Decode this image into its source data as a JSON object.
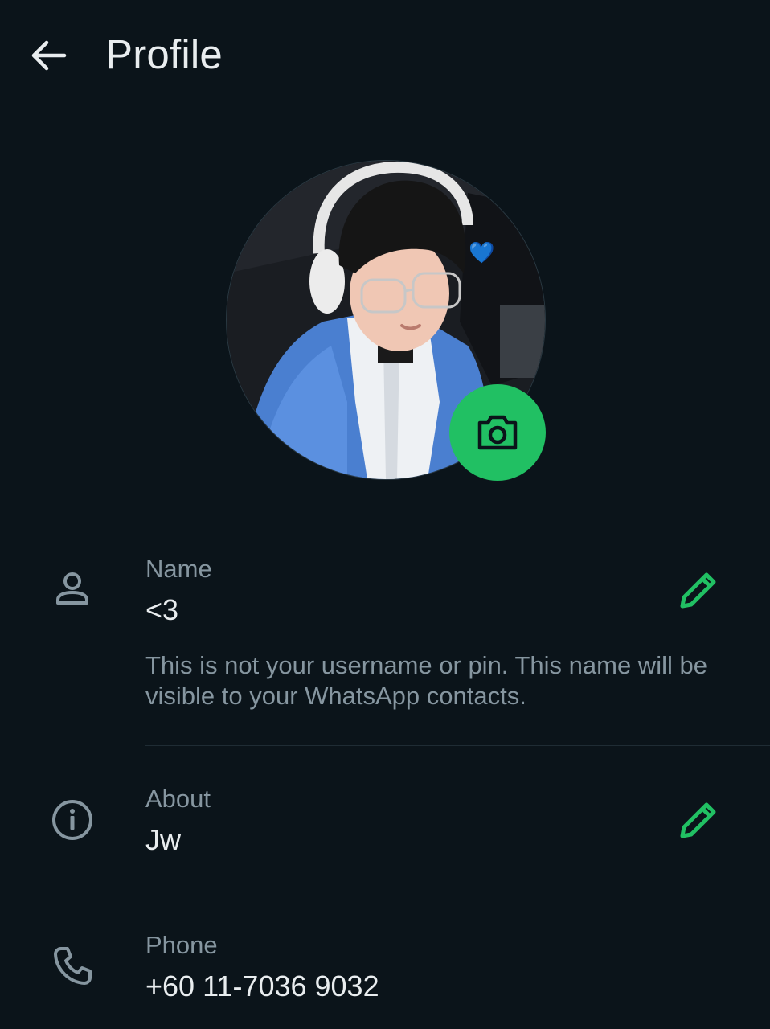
{
  "header": {
    "title": "Profile"
  },
  "profile": {
    "photo_emoji": "💙",
    "name": {
      "label": "Name",
      "value": "<3",
      "hint": "This is not your username or pin. This name will be visible to your WhatsApp contacts."
    },
    "about": {
      "label": "About",
      "value": "Jw"
    },
    "phone": {
      "label": "Phone",
      "value": "+60 11-7036 9032"
    }
  },
  "colors": {
    "accent": "#21c063",
    "background": "#0b141a",
    "secondary_text": "#8696a0"
  }
}
